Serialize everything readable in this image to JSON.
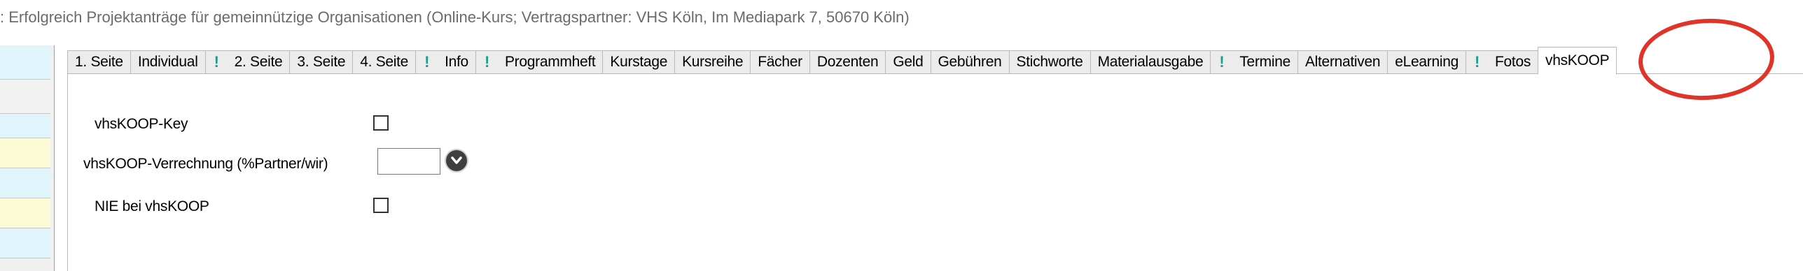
{
  "window": {
    "title": ": Erfolgreich Projektanträge für gemeinnützige Organisationen (Online-Kurs; Vertragspartner: VHS Köln, Im Mediapark 7, 50670 Köln)"
  },
  "tabs": [
    {
      "label": "1. Seite",
      "flag": false
    },
    {
      "label": "Individual",
      "flag": false
    },
    {
      "label": "2. Seite",
      "flag": true
    },
    {
      "label": "3. Seite",
      "flag": false
    },
    {
      "label": "4. Seite",
      "flag": false
    },
    {
      "label": "Info",
      "flag": true
    },
    {
      "label": "Programmheft",
      "flag": true
    },
    {
      "label": "Kurstage",
      "flag": false
    },
    {
      "label": "Kursreihe",
      "flag": false
    },
    {
      "label": "Fächer",
      "flag": false
    },
    {
      "label": "Dozenten",
      "flag": false
    },
    {
      "label": "Geld",
      "flag": false
    },
    {
      "label": "Gebühren",
      "flag": false
    },
    {
      "label": "Stichworte",
      "flag": false
    },
    {
      "label": "Materialausgabe",
      "flag": false
    },
    {
      "label": "Termine",
      "flag": true
    },
    {
      "label": "Alternativen",
      "flag": false
    },
    {
      "label": "eLearning",
      "flag": false
    },
    {
      "label": "Fotos",
      "flag": true
    },
    {
      "label": "vhsKOOP",
      "flag": false,
      "active": true
    }
  ],
  "form": {
    "key_label": "vhsKOOP-Key",
    "key_checked": false,
    "verrechnung_label": "vhsKOOP-Verrechnung (%Partner/wir)",
    "verrechnung_value": "",
    "nie_label": "NIE bei vhsKOOP",
    "nie_checked": false
  },
  "colors": {
    "flag": "#1e9c90",
    "highlight": "#e0332a",
    "left_cells": [
      "#dff4fb",
      "#f2f2f2",
      "#dff4fb",
      "#fdfbd6",
      "#dff4fb",
      "#fdfbd6"
    ]
  },
  "icons": {
    "flag": "exclamation-icon",
    "dropdown": "chevron-down-icon"
  }
}
